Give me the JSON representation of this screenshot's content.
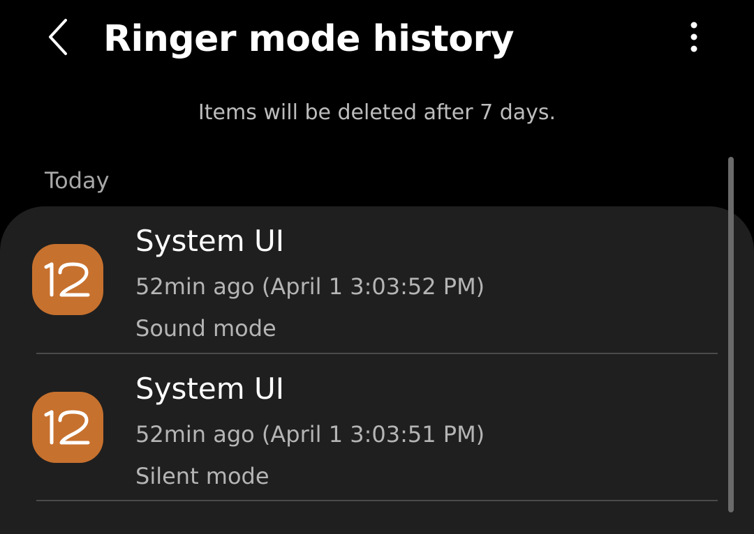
{
  "header": {
    "title": "Ringer mode history",
    "back_icon": "chevron-left-icon",
    "more_icon": "more-vertical-icon"
  },
  "notice": "Items will be deleted after 7 days.",
  "section": {
    "label": "Today"
  },
  "items": [
    {
      "app_name": "System UI",
      "timestamp": "52min ago (April 1 3:03:52 PM)",
      "mode": "Sound mode",
      "icon": "one-ui-12-icon",
      "icon_color": "#c7712e"
    },
    {
      "app_name": "System UI",
      "timestamp": "52min ago (April 1 3:03:51 PM)",
      "mode": "Silent mode",
      "icon": "one-ui-12-icon",
      "icon_color": "#c7712e"
    }
  ],
  "colors": {
    "background": "#000000",
    "card": "#1f1f1f",
    "accent": "#c7712e"
  }
}
